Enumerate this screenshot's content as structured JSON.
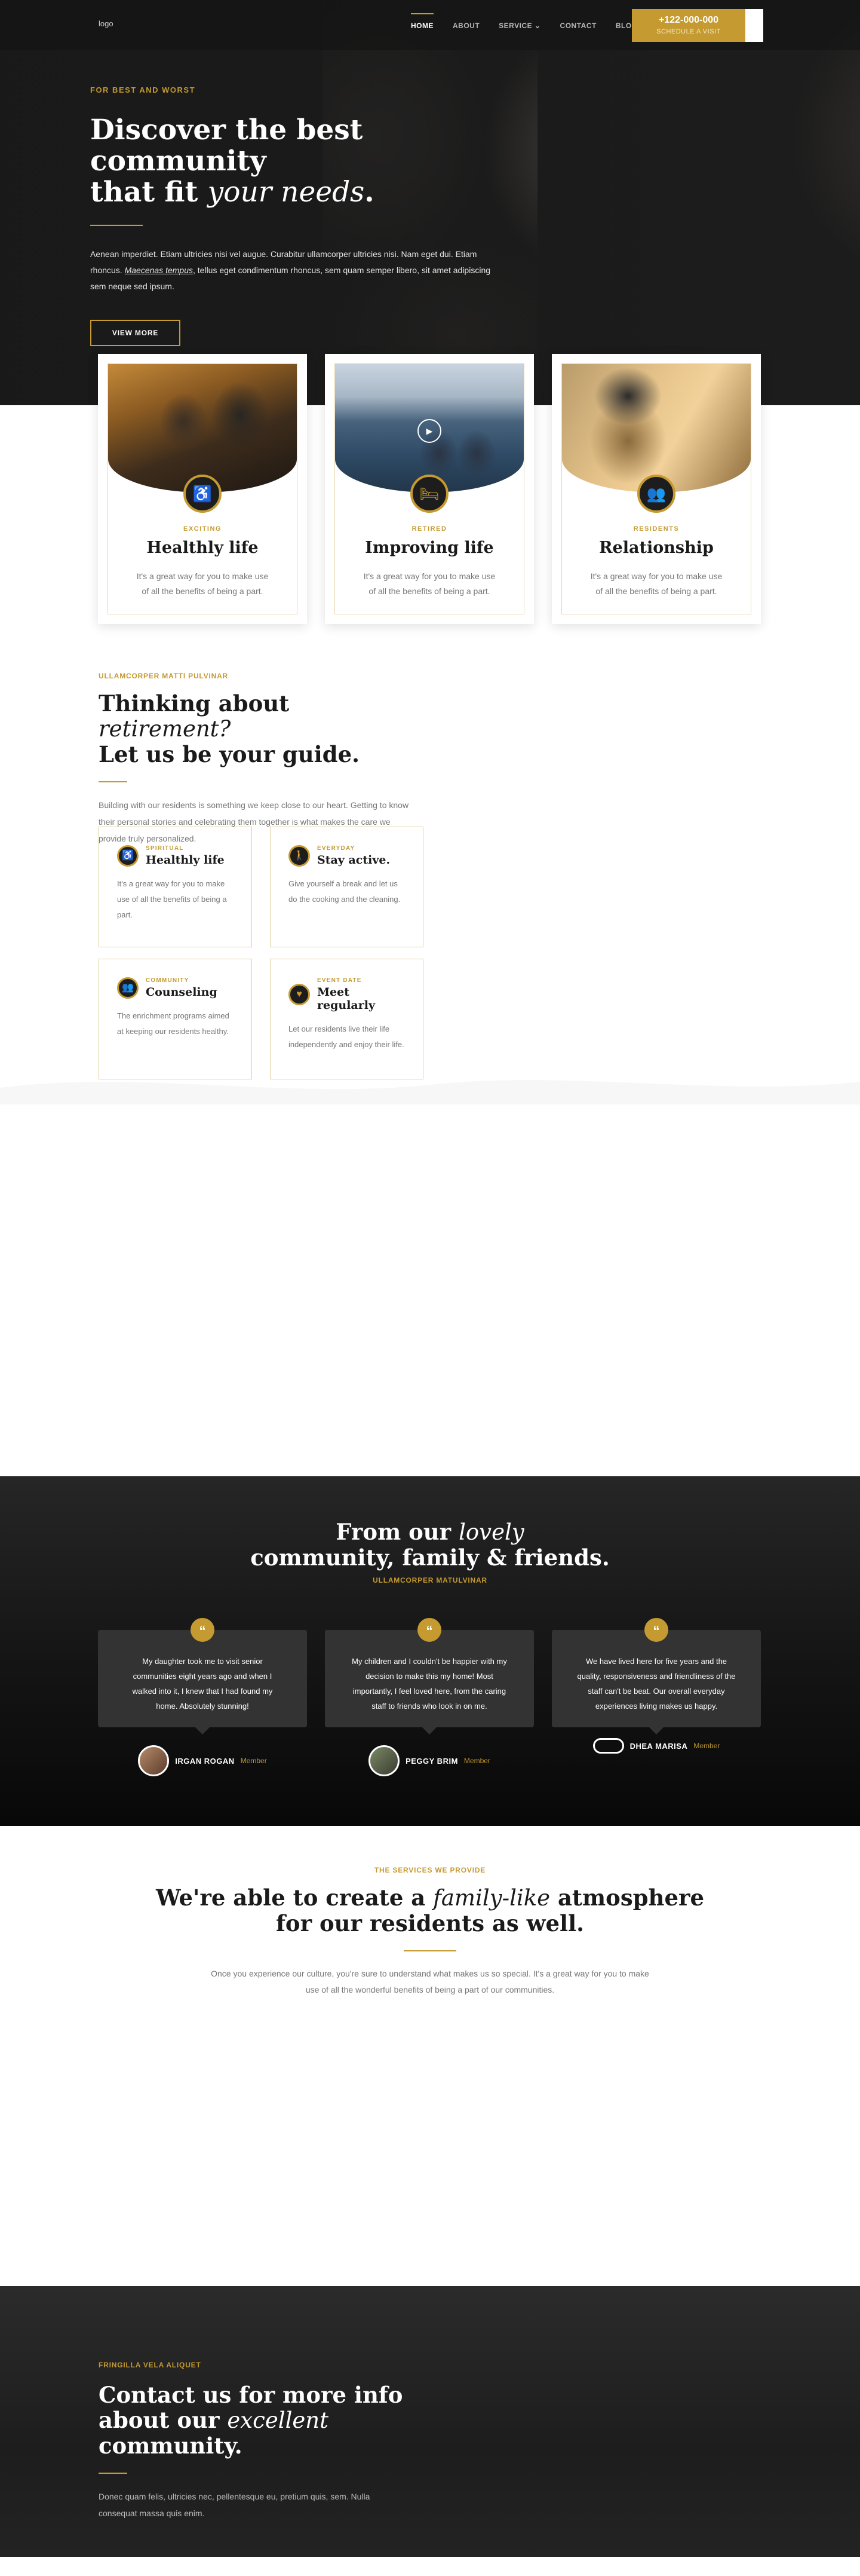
{
  "header": {
    "logo_alt": "logo",
    "nav": [
      {
        "label": "HOME",
        "active": true
      },
      {
        "label": "ABOUT",
        "active": false
      },
      {
        "label": "SERVICE",
        "active": false,
        "dropdown": true
      },
      {
        "label": "CONTACT",
        "active": false
      },
      {
        "label": "BLOG",
        "active": false,
        "dropdown": true
      }
    ],
    "cta_phone": "+122-000-000",
    "cta_sub": "SCHEDULE A VISIT",
    "accent_color": "#c59a30"
  },
  "hero": {
    "eyebrow": "FOR BEST AND WORST",
    "title_line1": "Discover the best community",
    "title_line2_prefix": "that fit ",
    "title_line2_em": "your needs",
    "title_line2_suffix": ".",
    "text_part1": "Aenean imperdiet. Etiam ultricies nisi vel augue. Curabitur ullamcorper ultricies nisi. Nam eget dui. Etiam rhoncus. ",
    "text_link": "Maecenas tempus",
    "text_part2": ", tellus eget condimentum rhoncus, sem quam semper libero, sit amet adipiscing sem neque sed ipsum.",
    "button": "VIEW MORE"
  },
  "cards": [
    {
      "tag": "EXCITING",
      "title": "Healthly life",
      "text": "It's a great way for you to make use of all the benefits of being a part.",
      "icon": "wheelchair-icon"
    },
    {
      "tag": "RETIRED",
      "title": "Improving life",
      "text": "It's a great way for you to make use of all the benefits of being a part.",
      "icon": "bed-icon"
    },
    {
      "tag": "RESIDENTS",
      "title": "Relationship",
      "text": "It's a great way for you to make use of all the benefits of being a part.",
      "icon": "group-icon"
    }
  ],
  "about": {
    "eyebrow": "ULLAMCORPER MATTI PULVINAR",
    "title_line1_prefix": "Thinking about ",
    "title_line1_em": "retirement?",
    "title_line2": "Let us be your guide.",
    "text": "Building with our residents is something we keep close to our heart. Getting to know their personal stories and celebrating them together is what makes the care we provide truly personalized."
  },
  "features": [
    {
      "tag": "SPIRITUAL",
      "title": "Healthly life",
      "text": "It's a great way for you to make use of all the benefits of being a part.",
      "icon": "wheelchair-icon"
    },
    {
      "tag": "EVERYDAY",
      "title": "Stay active.",
      "text": "Give yourself a break and let us do the cooking and the cleaning.",
      "icon": "walking-icon"
    },
    {
      "tag": "COMMUNITY",
      "title": "Counseling",
      "text": "The enrichment programs aimed at keeping our residents healthy.",
      "icon": "group-icon"
    },
    {
      "tag": "EVENT DATE",
      "title": "Meet regularly",
      "text": "Let our residents live their life independently and enjoy their life.",
      "icon": "heart-icon"
    }
  ],
  "testimonials": {
    "title_line1_prefix": "From our ",
    "title_line1_em": "lovely",
    "title_line2": "community, family & friends.",
    "subtitle": "ULLAMCORPER MATULVINAR",
    "items": [
      {
        "quote": "My daughter took me to visit senior communities eight years ago and when I walked into it, I knew that I had found my home. Absolutely stunning!",
        "name": "IRGAN ROGAN",
        "role": "Member"
      },
      {
        "quote": "My children and I couldn't be happier with my decision to make this my home! Most importantly, I feel loved here, from the caring staff to friends who look in on me.",
        "name": "PEGGY BRIM",
        "role": "Member"
      },
      {
        "quote": "We have lived here for five years and the quality, responsiveness and friendliness of the staff can't be beat. Our overall everyday experiences living makes us happy.",
        "name": "DHEA MARISA",
        "role": "Member"
      }
    ]
  },
  "services": {
    "eyebrow": "THE SERVICES WE PROVIDE",
    "title_line1_prefix": "We're able to create a ",
    "title_line1_em": "family-like",
    "title_line1_suffix": " atmosphere",
    "title_line2": "for our residents as well.",
    "text": "Once you experience our culture, you're sure to understand what makes us so special.  It's a great way for you to make use of all the wonderful benefits of being a part of our communities."
  },
  "contact": {
    "eyebrow": "FRINGILLA VELA ALIQUET",
    "title_line1": "Contact us for more info",
    "title_line2_prefix": "about our ",
    "title_line2_em": "excellent",
    "title_line2_suffix": " community.",
    "text": "Donec quam felis, ultricies nec, pellentesque eu, pretium quis, sem. Nulla consequat massa quis enim."
  }
}
